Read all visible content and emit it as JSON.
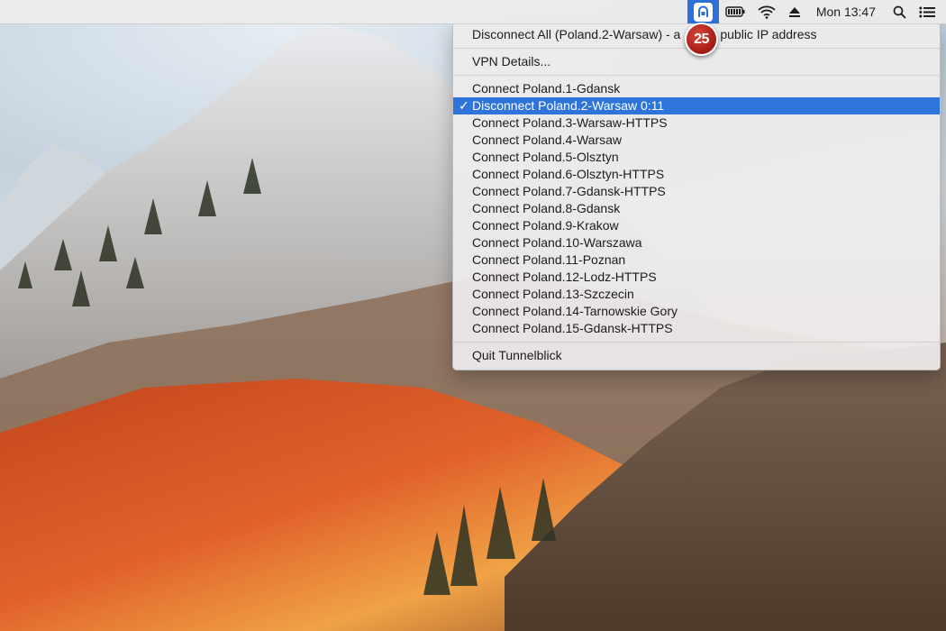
{
  "menubar": {
    "clock": "Mon 13:47",
    "icons": [
      "tunnelblick-icon",
      "battery-icon",
      "wifi-icon",
      "eject-icon",
      "spotlight-search-icon",
      "notification-center-icon"
    ],
    "accent_color": "#2e6fda"
  },
  "tutorial_badge": {
    "label": "25",
    "color": "#b0231c"
  },
  "vpn_menu": {
    "disconnect_all": "Disconnect All (Poland.2-Warsaw) - a",
    "disconnect_all_tail": "rent public IP address",
    "vpn_details": "VPN Details...",
    "connections": [
      {
        "label": "Connect Poland.1-Gdansk",
        "connected": false
      },
      {
        "label": "Disconnect Poland.2-Warsaw 0:11",
        "connected": true
      },
      {
        "label": "Connect Poland.3-Warsaw-HTTPS",
        "connected": false
      },
      {
        "label": "Connect Poland.4-Warsaw",
        "connected": false
      },
      {
        "label": "Connect Poland.5-Olsztyn",
        "connected": false
      },
      {
        "label": "Connect Poland.6-Olsztyn-HTTPS",
        "connected": false
      },
      {
        "label": "Connect Poland.7-Gdansk-HTTPS",
        "connected": false
      },
      {
        "label": "Connect Poland.8-Gdansk",
        "connected": false
      },
      {
        "label": "Connect Poland.9-Krakow",
        "connected": false
      },
      {
        "label": "Connect Poland.10-Warszawa",
        "connected": false
      },
      {
        "label": "Connect Poland.11-Poznan",
        "connected": false
      },
      {
        "label": "Connect Poland.12-Lodz-HTTPS",
        "connected": false
      },
      {
        "label": "Connect Poland.13-Szczecin",
        "connected": false
      },
      {
        "label": "Connect Poland.14-Tarnowskie Gory",
        "connected": false
      },
      {
        "label": "Connect Poland.15-Gdansk-HTTPS",
        "connected": false
      }
    ],
    "checkmark": "✓",
    "quit": "Quit Tunnelblick",
    "highlight_color": "#2e74da"
  }
}
